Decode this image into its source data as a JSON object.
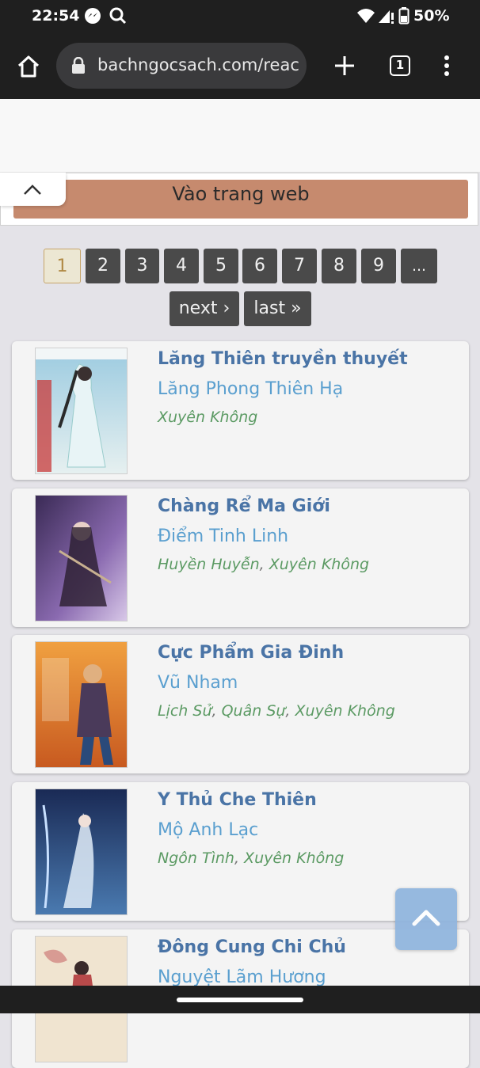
{
  "status_bar": {
    "time": "22:54",
    "battery": "50%",
    "icons": [
      "messenger-icon",
      "search-icon",
      "wifi-icon",
      "signal-icon",
      "battery-icon"
    ]
  },
  "browser": {
    "url": "bachngocsach.com/reac",
    "tab_count": "1",
    "icons": [
      "home-icon",
      "lock-icon",
      "new-tab-icon",
      "tab-switcher-icon",
      "more-menu-icon"
    ]
  },
  "banner": {
    "label": "Vào trang web",
    "collapse_icon": "chevron-up-icon"
  },
  "pagination": {
    "pages": [
      "1",
      "2",
      "3",
      "4",
      "5",
      "6",
      "7",
      "8",
      "9",
      "..."
    ],
    "current": "1",
    "next_label": "next ›",
    "last_label": "last »"
  },
  "books": [
    {
      "title": "Lăng Thiên truyền thuyết",
      "author": "Lăng Phong Thiên Hạ",
      "genres": [
        "Xuyên Không"
      ]
    },
    {
      "title": "Chàng Rể Ma Giới",
      "author": "Điểm Tinh Linh",
      "genres": [
        "Huyền Huyễn",
        "Xuyên Không"
      ]
    },
    {
      "title": "Cực Phẩm Gia Đinh",
      "author": "Vũ Nham",
      "genres": [
        "Lịch Sử",
        "Quân Sự",
        "Xuyên Không"
      ]
    },
    {
      "title": "Y Thủ Che Thiên",
      "author": "Mộ Anh Lạc",
      "genres": [
        "Ngôn Tình",
        "Xuyên Không"
      ]
    },
    {
      "title": "Đông Cung Chi Chủ",
      "author": "Nguyệt Lãm Hương",
      "genres": []
    }
  ],
  "colors": {
    "title": "#4a74a6",
    "author": "#5a9fcf",
    "genre": "#5b9a63",
    "page_active": "#b08a45",
    "banner": "#c68a6e"
  }
}
